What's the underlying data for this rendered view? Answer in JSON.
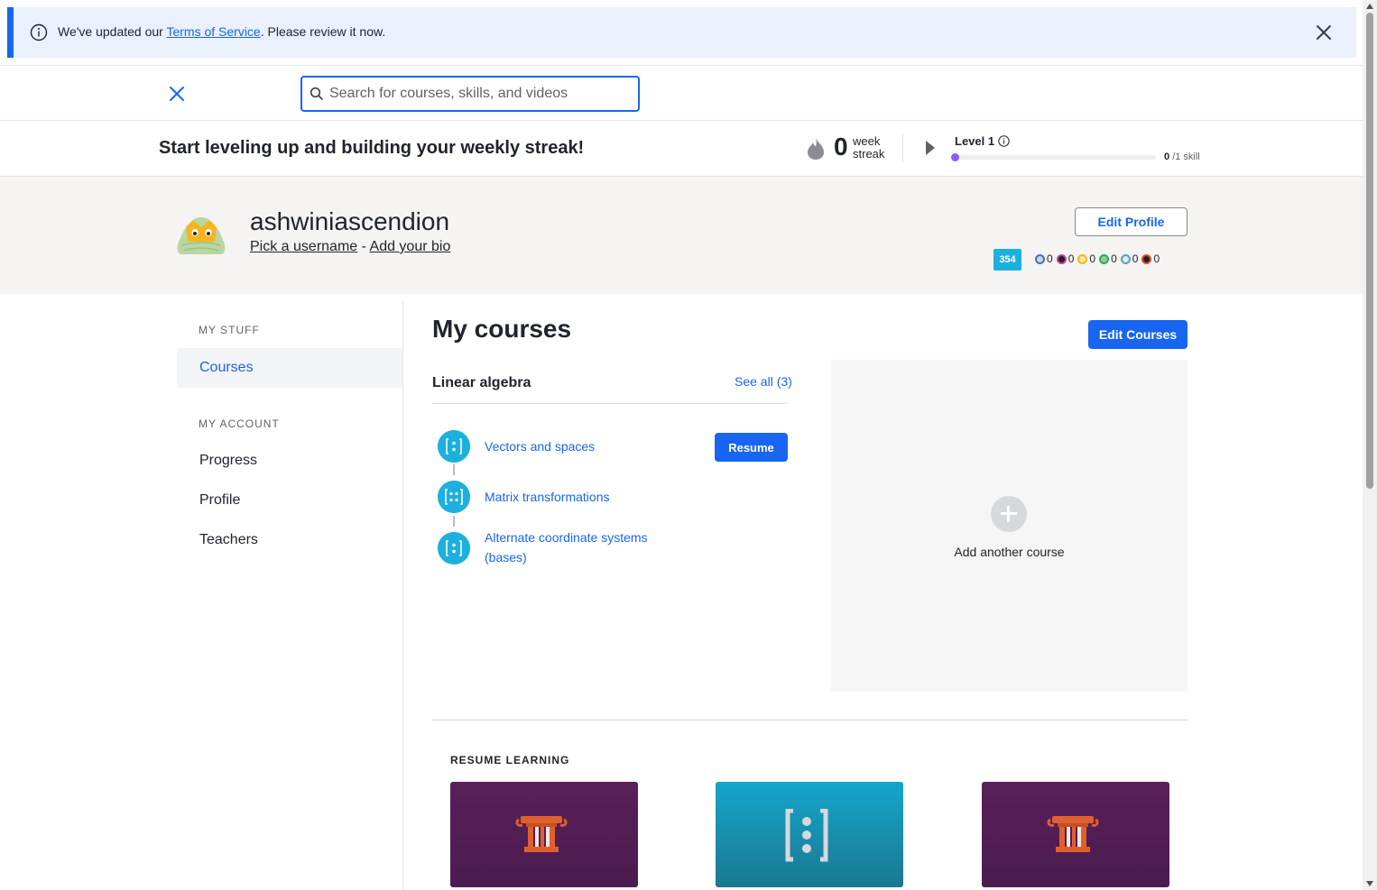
{
  "banner": {
    "prefix": "We've updated our ",
    "link": "Terms of Service",
    "suffix": ". Please review it now."
  },
  "search": {
    "placeholder": "Search for courses, skills, and videos",
    "value": ""
  },
  "streak": {
    "title": "Start leveling up and building your weekly streak!",
    "count": "0",
    "label_line1": "week",
    "label_line2": "streak",
    "level_label": "Level 1",
    "level_progress": 0,
    "skills_done": "0",
    "skills_total": "/1 skill"
  },
  "profile": {
    "username": "ashwiniascendion",
    "pick_username": "Pick a username",
    "separator": " - ",
    "add_bio": "Add your bio",
    "edit_button": "Edit Profile",
    "points": "354",
    "badges": [
      {
        "name": "meteorite",
        "count": "0",
        "color": "#4b6fb5"
      },
      {
        "name": "moon",
        "count": "0",
        "color": "#c43f8f"
      },
      {
        "name": "earth",
        "count": "0",
        "color": "#f5b520"
      },
      {
        "name": "sun",
        "count": "0",
        "color": "#3fa357"
      },
      {
        "name": "black-hole",
        "count": "0",
        "color": "#5ba4b5"
      },
      {
        "name": "challenge-patch",
        "count": "0",
        "color": "#d9502b"
      }
    ]
  },
  "sidebar": {
    "my_stuff_head": "MY STUFF",
    "courses": "Courses",
    "my_account_head": "MY ACCOUNT",
    "progress": "Progress",
    "profile": "Profile",
    "teachers": "Teachers"
  },
  "main": {
    "title": "My courses",
    "edit_courses": "Edit Courses",
    "course_name": "Linear algebra",
    "see_all": "See all (3)",
    "units": [
      {
        "line1": "Vectors and spaces",
        "line2": ""
      },
      {
        "line1": "Matrix transformations",
        "line2": ""
      },
      {
        "line1": "Alternate coordinate systems",
        "line2": "(bases)"
      }
    ],
    "resume_button": "Resume",
    "add_course": "Add another course",
    "resume_learning_head": "RESUME LEARNING"
  },
  "colors": {
    "accent": "#1865f2",
    "unit_icon": "#1cb0de",
    "level_fill": "#9059ff"
  }
}
